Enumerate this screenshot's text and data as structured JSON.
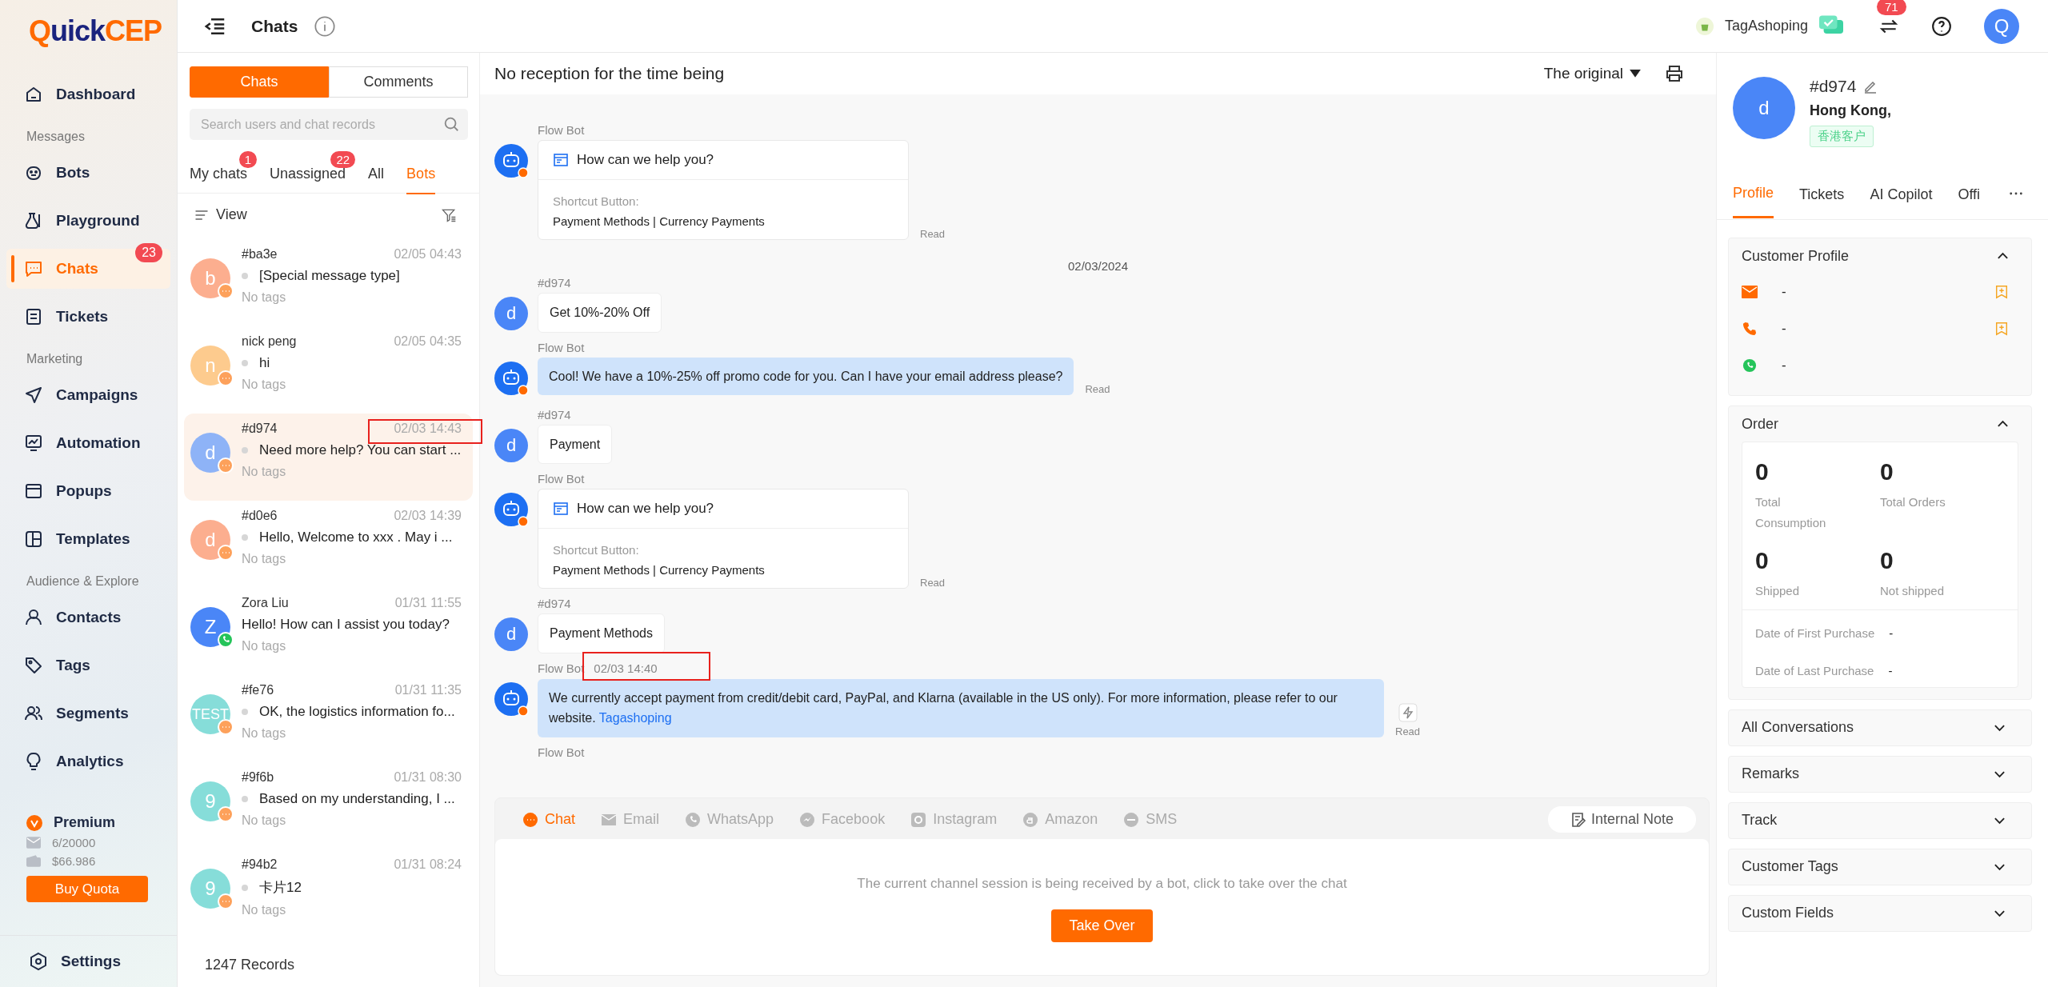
{
  "sidebar": {
    "logo": {
      "prefix": "Q",
      "rest": "uick",
      "suffix": "CEP"
    },
    "items": [
      {
        "kind": "item",
        "label": "Dashboard",
        "selected": false
      },
      {
        "kind": "section",
        "label": "Messages"
      },
      {
        "kind": "item",
        "label": "Bots",
        "selected": false
      },
      {
        "kind": "item",
        "label": "Playground",
        "selected": false
      },
      {
        "kind": "item",
        "label": "Chats",
        "selected": true,
        "badge": "23"
      },
      {
        "kind": "item",
        "label": "Tickets",
        "selected": false
      },
      {
        "kind": "section",
        "label": "Marketing"
      },
      {
        "kind": "item",
        "label": "Campaigns",
        "selected": false
      },
      {
        "kind": "item",
        "label": "Automation",
        "selected": false
      },
      {
        "kind": "item",
        "label": "Popups",
        "selected": false
      },
      {
        "kind": "item",
        "label": "Templates",
        "selected": false
      },
      {
        "kind": "section",
        "label": "Audience & Explore"
      },
      {
        "kind": "item",
        "label": "Contacts",
        "selected": false
      },
      {
        "kind": "item",
        "label": "Tags",
        "selected": false
      },
      {
        "kind": "item",
        "label": "Segments",
        "selected": false
      },
      {
        "kind": "item",
        "label": "Analytics",
        "selected": false
      }
    ],
    "plan": {
      "name": "Premium",
      "emails": "6/20000",
      "balance": "$66.986",
      "button": "Buy Quota"
    },
    "settings": "Settings"
  },
  "header": {
    "title": "Chats",
    "store": "TagAshoping",
    "notifications": "71",
    "avatar": "Q"
  },
  "chat_list": {
    "segments": [
      {
        "label": "Chats",
        "selected": true
      },
      {
        "label": "Comments",
        "selected": false
      }
    ],
    "search": {
      "placeholder": "Search users and chat records"
    },
    "tabs": [
      {
        "label": "My chats",
        "badge": "1",
        "selected": false
      },
      {
        "label": "Unassigned",
        "badge": "22",
        "selected": false
      },
      {
        "label": "All",
        "selected": false
      },
      {
        "label": "Bots",
        "selected": true
      }
    ],
    "view": "View",
    "items": [
      {
        "name": "#ba3e",
        "time": "02/05 04:43",
        "preview": "[Special message type]",
        "tags": "No tags",
        "letter": "b",
        "color": "#fcae8f",
        "kind": "chat",
        "dot": true,
        "selected": false
      },
      {
        "name": "nick peng",
        "time": "02/05 04:35",
        "preview": "hi",
        "tags": "No tags",
        "letter": "n",
        "color": "#fdcb8e",
        "kind": "chat",
        "dot": true,
        "selected": false
      },
      {
        "name": "#d974",
        "time": "02/03 14:43",
        "preview": "Need more help? You can start ...",
        "tags": "No tags",
        "letter": "d",
        "color": "#8eb3f7",
        "kind": "chat",
        "dot": true,
        "selected": true,
        "highlighted": true
      },
      {
        "name": "#d0e6",
        "time": "02/03 14:39",
        "preview": "Hello, Welcome to xxx . May i ...",
        "tags": "No tags",
        "letter": "d",
        "color": "#fcae8f",
        "kind": "chat",
        "dot": true,
        "selected": false
      },
      {
        "name": "Zora Liu",
        "time": "01/31 11:55",
        "preview": "Hello! How can I assist you today?",
        "tags": "No tags",
        "letter": "Z",
        "color": "#4a86f7",
        "kind": "whatsapp",
        "dot": false,
        "selected": false
      },
      {
        "name": "#fe76",
        "time": "01/31 11:35",
        "preview": "OK, the logistics information fo...",
        "tags": "No tags",
        "letter": "TEST",
        "color": "#86ddd9",
        "kind": "chat",
        "dot": true,
        "selected": false
      },
      {
        "name": "#9f6b",
        "time": "01/31 08:30",
        "preview": "Based on my understanding, I ...",
        "tags": "No tags",
        "letter": "9",
        "color": "#86ddd9",
        "kind": "chat",
        "dot": true,
        "selected": false
      },
      {
        "name": "#94b2",
        "time": "01/31 08:24",
        "preview": "卡片12",
        "tags": "No tags",
        "letter": "9",
        "color": "#86ddd9",
        "kind": "chat",
        "dot": true,
        "selected": false
      }
    ],
    "records": "1247 Records"
  },
  "conversation": {
    "status": "No reception for the time being",
    "translation": "The original",
    "messages": [
      {
        "kind": "card",
        "sender": "Flow Bot",
        "title": "How can we help you?",
        "label": "Shortcut Button:",
        "options": "Payment Methods | Currency Payments",
        "status": "Read"
      },
      {
        "kind": "date",
        "text": "02/03/2024"
      },
      {
        "kind": "user",
        "sender": "#d974",
        "letter": "d",
        "text": "Get 10%-20% Off"
      },
      {
        "kind": "bot",
        "sender": "Flow Bot",
        "text": "Cool! We have a 10%-25% off promo code for you. Can I have your email address please?",
        "status": "Read"
      },
      {
        "kind": "user",
        "sender": "#d974",
        "letter": "d",
        "text": "Payment"
      },
      {
        "kind": "card",
        "sender": "Flow Bot",
        "title": "How can we help you?",
        "label": "Shortcut Button:",
        "options": "Payment Methods | Currency Payments",
        "status": "Read"
      },
      {
        "kind": "user",
        "sender": "#d974",
        "letter": "d",
        "text": "Payment Methods"
      },
      {
        "kind": "bot",
        "sender": "Flow Bot",
        "time": "02/03 14:40",
        "highlighted": true,
        "text": "We currently accept payment from credit/debit card, PayPal, and Klarna (available in the US only). For more information, please refer to our website.",
        "link": "Tagashoping",
        "action_icon": true,
        "status": "Read"
      },
      {
        "kind": "label",
        "sender": "Flow Bot"
      }
    ],
    "channels": [
      {
        "label": "Chat",
        "selected": true
      },
      {
        "label": "Email",
        "selected": false
      },
      {
        "label": "WhatsApp",
        "selected": false
      },
      {
        "label": "Facebook",
        "selected": false
      },
      {
        "label": "Instagram",
        "selected": false
      },
      {
        "label": "Amazon",
        "selected": false
      },
      {
        "label": "SMS",
        "selected": false
      }
    ],
    "internal_note": "Internal Note",
    "notice": "The current channel session is being received by a bot, click to take over the chat",
    "take_over": "Take Over"
  },
  "customer": {
    "letter": "d",
    "name": "#d974",
    "location": "Hong Kong,",
    "tag": "香港客户",
    "tabs": [
      {
        "label": "Profile",
        "selected": true
      },
      {
        "label": "Tickets",
        "selected": false
      },
      {
        "label": "AI Copilot",
        "selected": false
      },
      {
        "label": "Offi",
        "selected": false
      }
    ],
    "profile": {
      "title": "Customer Profile",
      "fields": [
        {
          "kind": "email",
          "value": "-",
          "addable": true
        },
        {
          "kind": "phone",
          "value": "-",
          "addable": true
        },
        {
          "kind": "whatsapp",
          "value": "-",
          "addable": false
        }
      ]
    },
    "order": {
      "title": "Order",
      "stats": [
        {
          "value": "0",
          "label": "Total Consumption"
        },
        {
          "value": "0",
          "label": "Total Orders"
        },
        {
          "value": "0",
          "label": "Shipped"
        },
        {
          "value": "0",
          "label": "Not shipped"
        }
      ],
      "dates": [
        {
          "label": "Date of First Purchase",
          "value": "-"
        },
        {
          "label": "Date of Last Purchase",
          "value": "-"
        }
      ]
    },
    "sections": [
      "All Conversations",
      "Remarks",
      "Track",
      "Customer Tags",
      "Custom Fields"
    ]
  }
}
